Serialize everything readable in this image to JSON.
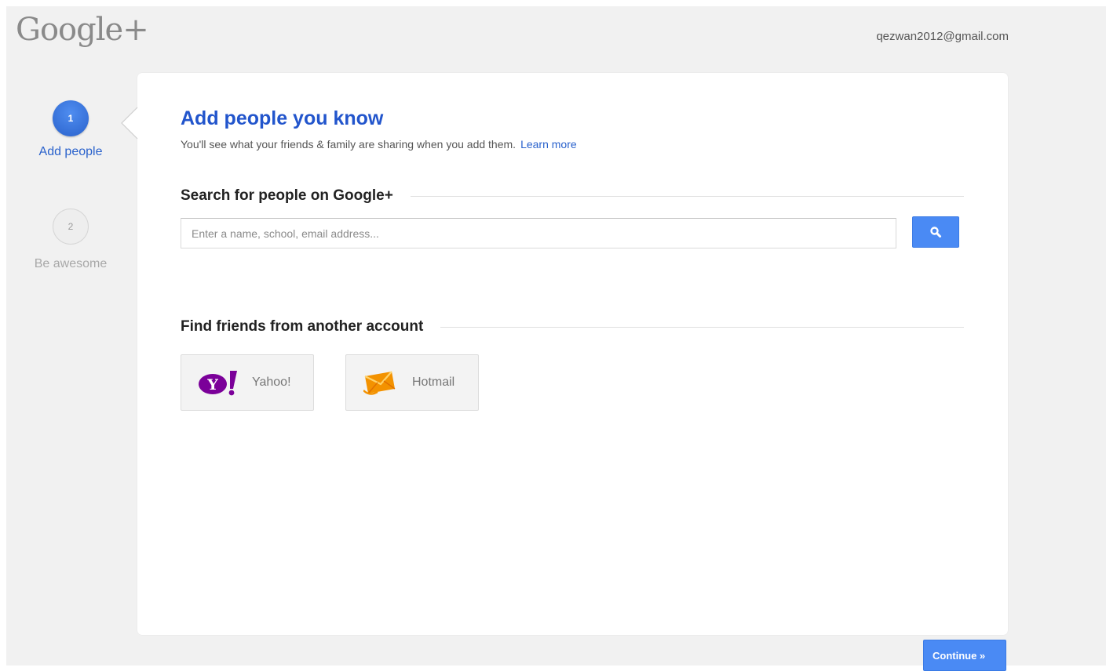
{
  "header": {
    "logo_text": "Google+",
    "user_email": "qezwan2012@gmail.com"
  },
  "stepper": {
    "steps": [
      {
        "number": "1",
        "label": "Add people",
        "active": true
      },
      {
        "number": "2",
        "label": "Be awesome",
        "active": false
      }
    ]
  },
  "main": {
    "title": "Add people you know",
    "subtitle": "You'll see what your friends & family are sharing when you add them.",
    "learn_more": "Learn more",
    "search_section": {
      "heading": "Search for people on Google+",
      "input_value": "",
      "placeholder": "Enter a name, school, email address...",
      "button_icon": "search-icon"
    },
    "friends_section": {
      "heading": "Find friends from another account",
      "providers": [
        {
          "label": "Yahoo!",
          "icon": "yahoo-logo-icon"
        },
        {
          "label": "Hotmail",
          "icon": "hotmail-envelope-icon"
        }
      ]
    }
  },
  "footer": {
    "continue_label": "Continue »"
  },
  "colors": {
    "accent": "#4a8af4",
    "title_blue": "#2255cc",
    "link_blue": "#2a62cc",
    "background": "#f1f1f1",
    "yahoo_purple": "#7b0099",
    "hotmail_orange": "#f39200"
  }
}
